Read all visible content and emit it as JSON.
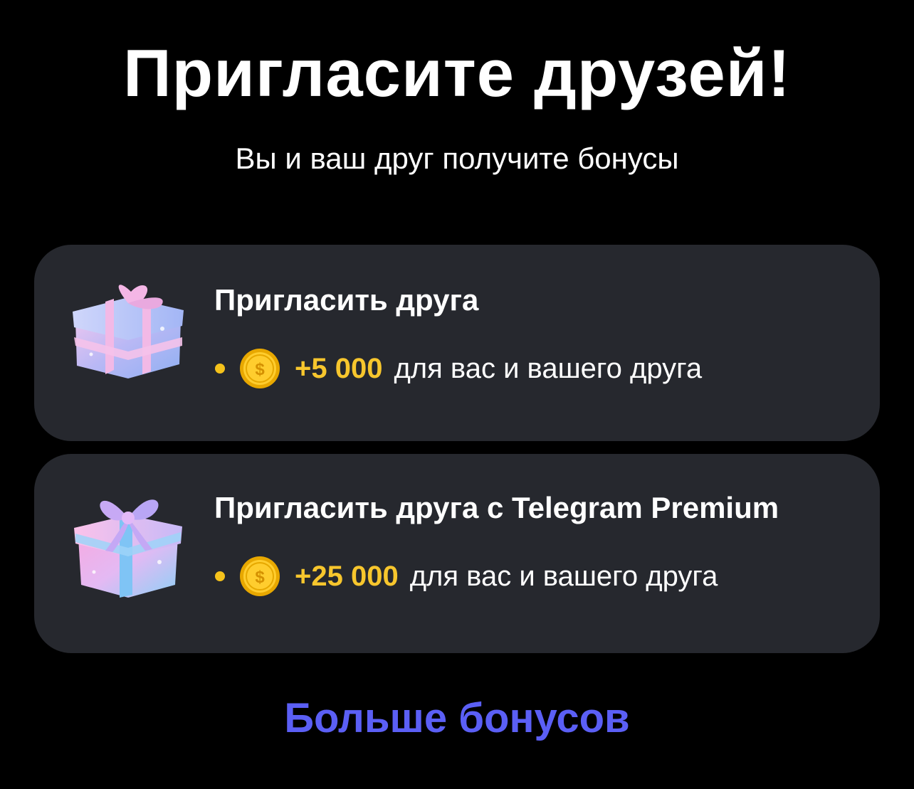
{
  "header": {
    "title": "Пригласите друзей!",
    "subtitle": "Вы и ваш друг получите бонусы"
  },
  "cards": [
    {
      "icon": "gift-icon",
      "title": "Пригласить друга",
      "amount": "+5 000",
      "reward_text": "для вас и вашего друга"
    },
    {
      "icon": "gift-icon",
      "title": "Пригласить друга с Telegram Premium",
      "amount": "+25 000",
      "reward_text": "для вас и вашего друга"
    }
  ],
  "footer": {
    "more_bonuses_label": "Больше бонусов"
  },
  "colors": {
    "background": "#000000",
    "card": "#26282e",
    "accent_gold": "#f7c62d",
    "link": "#5b5ff5"
  }
}
